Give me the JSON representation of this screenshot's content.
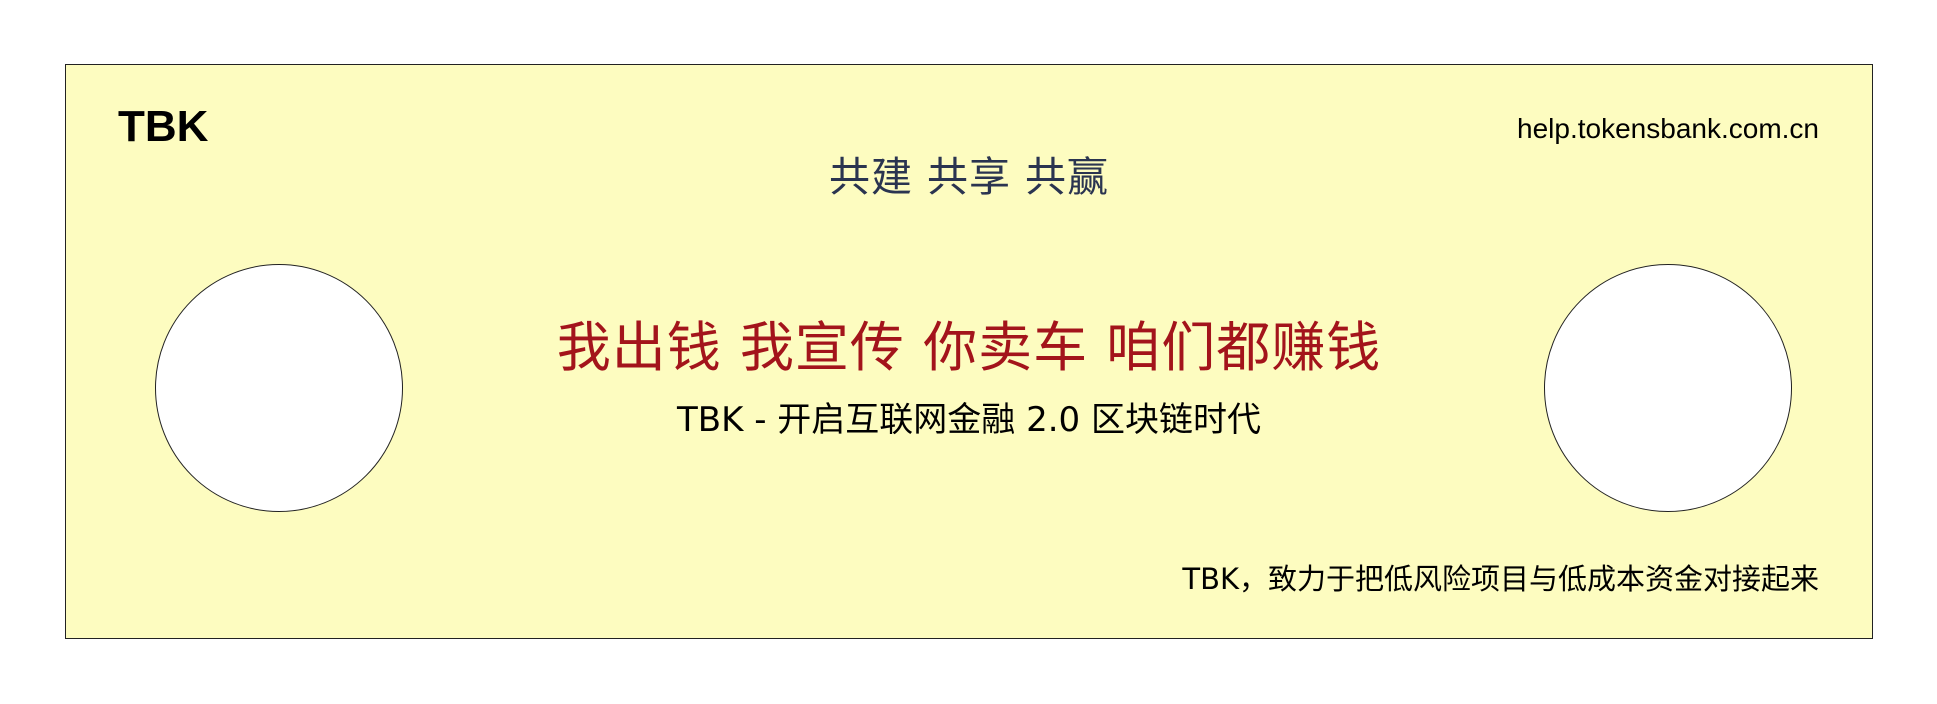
{
  "brand": "TBK",
  "url": "help.tokensbank.com.cn",
  "slogan": "共建 共享 共赢",
  "headline": "我出钱 我宣传 你卖车 咱们都赚钱",
  "subline": "TBK - 开启互联网金融 2.0 区块链时代",
  "mission": "TBK，致力于把低风险项目与低成本资金对接起来",
  "colors": {
    "background": "#fdfcc0",
    "headline": "#a3141b",
    "slogan": "#2a3450",
    "text": "#000000"
  }
}
